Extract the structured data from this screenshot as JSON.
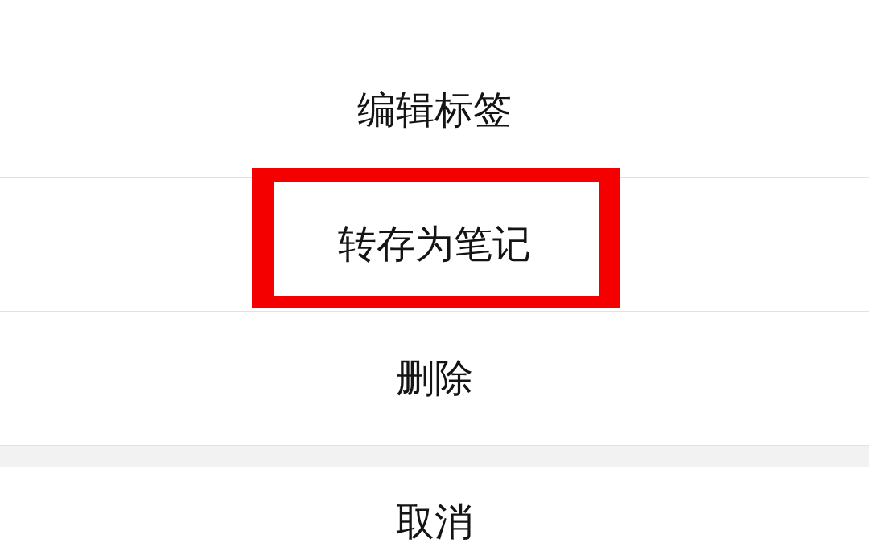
{
  "menu": {
    "items": [
      {
        "label": "编辑标签",
        "highlighted": false
      },
      {
        "label": "转存为笔记",
        "highlighted": true
      },
      {
        "label": "删除",
        "highlighted": false
      }
    ]
  },
  "cancel": {
    "label": "取消"
  }
}
